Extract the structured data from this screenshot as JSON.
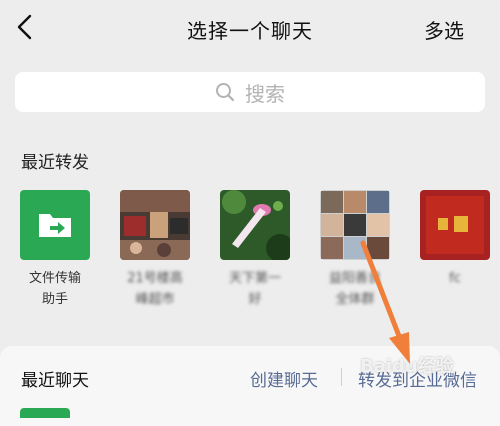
{
  "header": {
    "title": "选择一个聊天",
    "multi_select": "多选",
    "back_icon": "chevron-left-icon"
  },
  "search": {
    "placeholder": "搜索",
    "icon": "search-icon"
  },
  "recent_forward": {
    "title": "最近转发",
    "items": [
      {
        "label": "文件传输\n助手",
        "icon": "folder-transfer-icon",
        "color": "#2aa853"
      },
      {
        "label": "21号楼高\n峰超市"
      },
      {
        "label": "天下第一\n好"
      },
      {
        "label": "益阳善良\n全体群"
      },
      {
        "label": "fc"
      }
    ]
  },
  "recent_chats": {
    "title": "最近聊天",
    "create": "创建聊天",
    "forward_enterprise": "转发到企业微信"
  },
  "watermark": "Baidu经验",
  "colors": {
    "accent_link": "#576b95",
    "wechat_green": "#2aa853",
    "arrow": "#f07f3c",
    "background": "#ededed"
  }
}
